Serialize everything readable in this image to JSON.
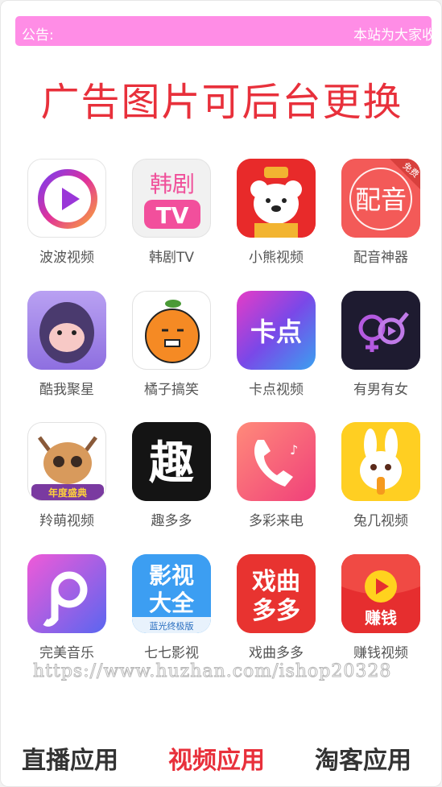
{
  "notice": {
    "label": "公告:",
    "text": "本站为大家收"
  },
  "banner": {
    "text": "广告图片可后台更换"
  },
  "apps": [
    {
      "name": "波波视频",
      "icon": "bobo-play-icon"
    },
    {
      "name": "韩剧TV",
      "icon": "hanju-tv-icon",
      "icon_text": "韩剧",
      "icon_text2": "TV"
    },
    {
      "name": "小熊视频",
      "icon": "bear-icon"
    },
    {
      "name": "配音神器",
      "icon": "peiyin-icon",
      "icon_text": "配音",
      "badge": "免费"
    },
    {
      "name": "酷我聚星",
      "icon": "gorilla-icon"
    },
    {
      "name": "橘子搞笑",
      "icon": "orange-face-icon"
    },
    {
      "name": "卡点视频",
      "icon": "kadian-icon",
      "icon_text": "卡点"
    },
    {
      "name": "有男有女",
      "icon": "gender-play-icon"
    },
    {
      "name": "羚萌视频",
      "icon": "deer-icon",
      "icon_text": "年度盛典"
    },
    {
      "name": "趣多多",
      "icon": "qu-icon",
      "icon_text": "趣"
    },
    {
      "name": "多彩来电",
      "icon": "phone-icon"
    },
    {
      "name": "兔几视频",
      "icon": "rabbit-icon"
    },
    {
      "name": "完美音乐",
      "icon": "music-p-icon"
    },
    {
      "name": "七七影视",
      "icon": "yingshi-icon",
      "icon_text": "影视",
      "icon_text2": "大全",
      "icon_text3": "蓝光终极版"
    },
    {
      "name": "戏曲多多",
      "icon": "xiqu-icon",
      "icon_text": "戏曲",
      "icon_text2": "多多"
    },
    {
      "name": "赚钱视频",
      "icon": "earn-play-icon",
      "icon_text": "赚钱"
    }
  ],
  "watermark": "https://www.huzhan.com/ishop20328",
  "tabs": [
    {
      "label": "直播应用",
      "active": false
    },
    {
      "label": "视频应用",
      "active": true
    },
    {
      "label": "淘客应用",
      "active": false
    }
  ],
  "colors": {
    "accent": "#e8303b",
    "notice_bg": "#ff8de6"
  }
}
